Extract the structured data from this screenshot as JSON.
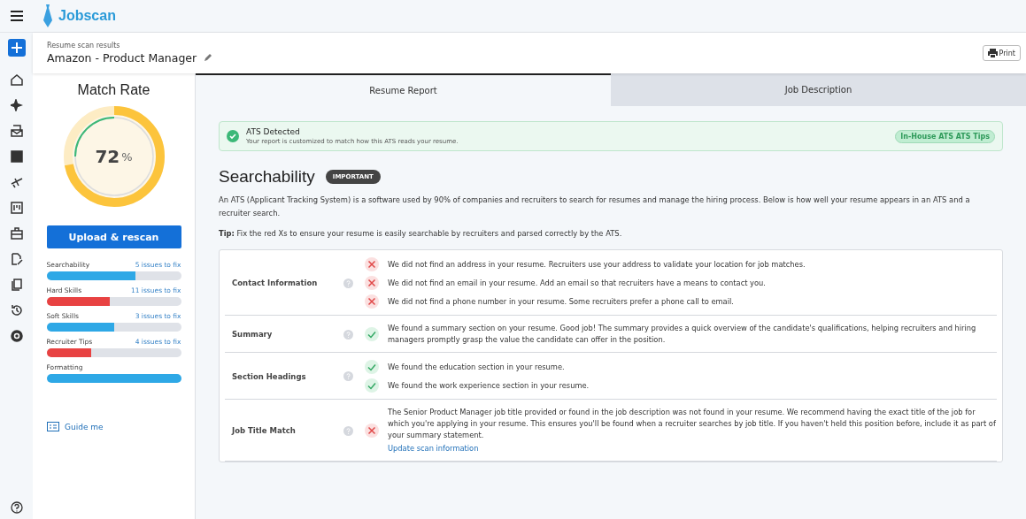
{
  "brand": "Jobscan",
  "header": {
    "caption": "Resume scan results",
    "title": "Amazon - Product Manager",
    "print": "Print"
  },
  "match": {
    "title": "Match Rate",
    "value": "72",
    "unit": "%",
    "level": 0.72
  },
  "upload_button": "Upload & rescan",
  "categories": [
    {
      "name": "Searchability",
      "issues": "5 issues to fix",
      "level": 0.66,
      "color": "#2ea8e6"
    },
    {
      "name": "Hard Skills",
      "issues": "11 issues to fix",
      "level": 0.47,
      "color": "#e84242"
    },
    {
      "name": "Soft Skills",
      "issues": "3 issues to fix",
      "level": 0.5,
      "color": "#2ea8e6"
    },
    {
      "name": "Recruiter Tips",
      "issues": "4 issues to fix",
      "level": 0.33,
      "color": "#e84242"
    },
    {
      "name": "Formatting",
      "level": 1.0,
      "color": "#2ea8e6"
    }
  ],
  "guide": "Guide me",
  "tabs": [
    {
      "label": "Resume Report",
      "selected": true
    },
    {
      "label": "Job Description",
      "selected": false
    }
  ],
  "ats": {
    "title": "ATS Detected",
    "text": "Your report is customized to match how this ATS reads your resume.",
    "tag": "In-House ATS ATS Tips"
  },
  "section": {
    "title": "Searchability",
    "badge": "IMPORTANT",
    "intro": "An ATS (Applicant Tracking System) is a software used by 90% of companies and recruiters to search for resumes and manage the hiring process. Below is how well your resume appears in an ATS and a recruiter search.",
    "tip": "**Tip:** Fix the red Xs to ensure your resume is easily searchable by recruiters and parsed correctly by the ATS."
  },
  "checks": [
    {
      "label": "Contact Information",
      "items": [
        {
          "kind": "fail",
          "text": "We did not find an address in your resume. Recruiters use your address to validate your location for job matches."
        },
        {
          "kind": "fail",
          "text": "We did not find an email in your resume. Add an email so that recruiters have a means to contact you."
        },
        {
          "kind": "fail",
          "text": "We did not find a phone number in your resume. Some recruiters prefer a phone call to email."
        }
      ]
    },
    {
      "label": "Summary",
      "items": [
        {
          "kind": "pass",
          "text": "We found a summary section on your resume. Good job! The summary provides a quick overview of the candidate's qualifications, helping recruiters and hiring managers promptly grasp the value the candidate can offer in the position."
        }
      ]
    },
    {
      "label": "Section Headings",
      "items": [
        {
          "kind": "pass",
          "text": "We found the education section in your resume."
        },
        {
          "kind": "pass",
          "text": "We found the work experience section in your resume."
        }
      ]
    },
    {
      "label": "Job Title Match",
      "items": [
        {
          "kind": "fail",
          "text": "The Senior Product Manager job title provided or found in the job description was not found in your resume. We recommend having the exact title of the job for which you're applying in your resume. This ensures you'll be found when a recruiter searches by job title. If you haven't held this position before, include it as part of your summary statement.",
          "link": "Update scan information"
        }
      ]
    }
  ]
}
